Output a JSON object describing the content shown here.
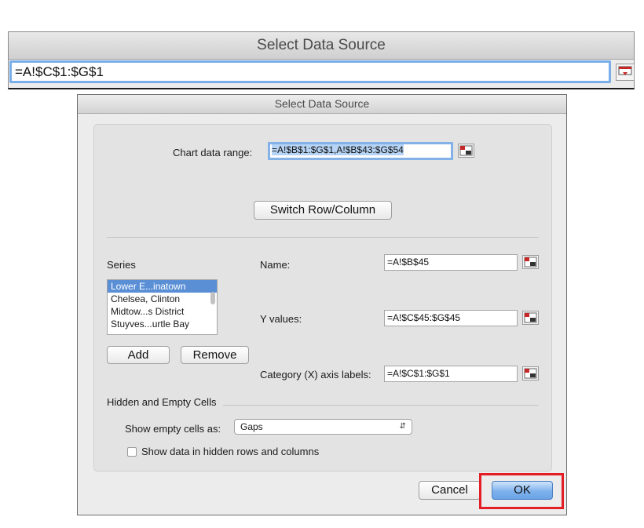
{
  "collapsed_dialog": {
    "title": "Select Data Source",
    "range_value": "=A!$C$1:$G$1",
    "picker_icon": "collapse-range-picker-icon"
  },
  "dialog": {
    "title": "Select Data Source",
    "chart_data_range": {
      "label": "Chart data range:",
      "value": "=A!$B$1:$G$1,A!$B$43:$G$54"
    },
    "switch_button": "Switch Row/Column",
    "series": {
      "label": "Series",
      "items": [
        {
          "label": "Lower E...inatown",
          "selected": true
        },
        {
          "label": "Chelsea, Clinton",
          "selected": false
        },
        {
          "label": "Midtow...s District",
          "selected": false
        },
        {
          "label": "Stuyves...urtle Bay",
          "selected": false
        }
      ],
      "add_button": "Add",
      "remove_button": "Remove"
    },
    "name": {
      "label": "Name:",
      "value": "=A!$B$45"
    },
    "y_values": {
      "label": "Y values:",
      "value": "=A!$C$45:$G$45"
    },
    "category_labels": {
      "label": "Category (X) axis labels:",
      "value": "=A!$C$1:$G$1"
    },
    "hidden_empty": {
      "heading": "Hidden and Empty Cells",
      "show_empty_label": "Show empty cells as:",
      "show_empty_value": "Gaps",
      "show_hidden_label": "Show data in hidden rows and columns",
      "show_hidden_checked": false
    },
    "cancel_button": "Cancel",
    "ok_button": "OK",
    "colors": {
      "focus_ring": "#83b1e8",
      "selection": "#5a8fd6",
      "highlight_annotation": "#e31e24"
    }
  }
}
